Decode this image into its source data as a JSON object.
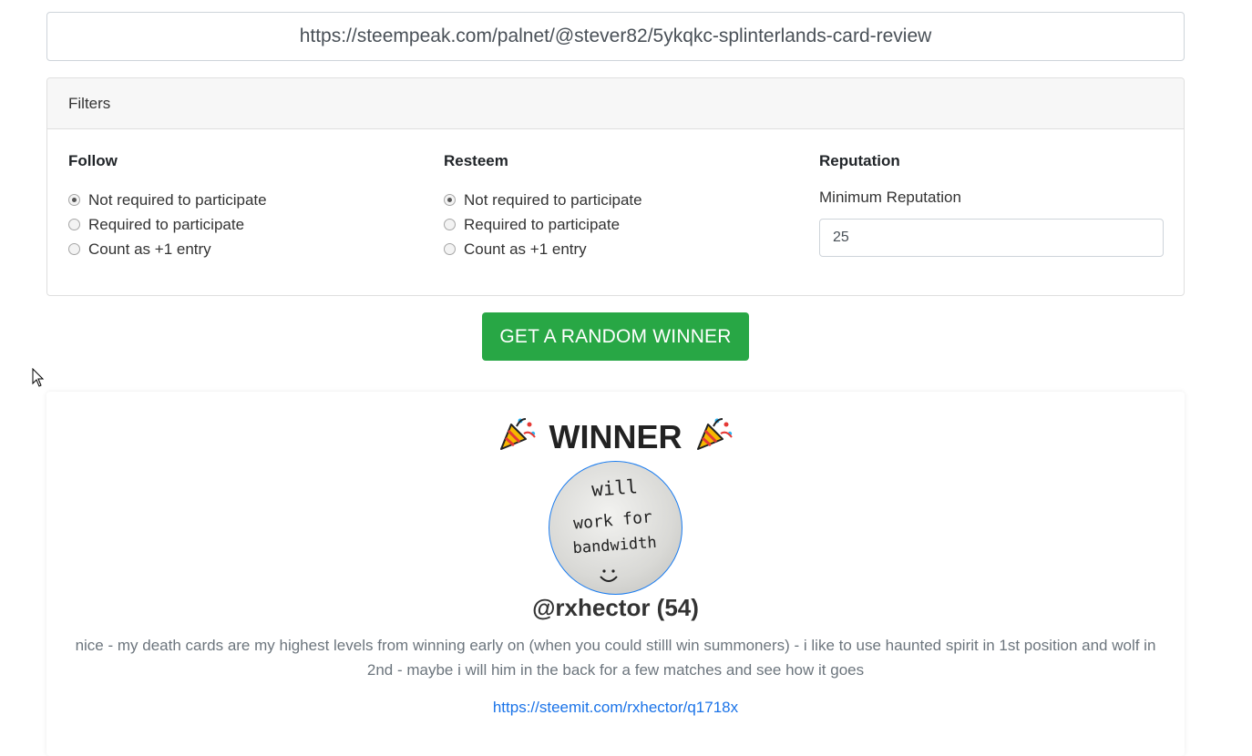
{
  "url_input": {
    "value": "https://steempeak.com/palnet/@stever82/5ykqkc-splinterlands-card-review"
  },
  "filters": {
    "header": "Filters",
    "follow": {
      "title": "Follow",
      "options": [
        "Not required to participate",
        "Required to participate",
        "Count as +1 entry"
      ],
      "selected": "Not required to participate"
    },
    "resteem": {
      "title": "Resteem",
      "options": [
        "Not required to participate",
        "Required to participate",
        "Count as +1 entry"
      ],
      "selected": "Not required to participate"
    },
    "reputation": {
      "title": "Reputation",
      "label": "Minimum Reputation",
      "value": "25"
    }
  },
  "action_button": {
    "label": "GET A RANDOM WINNER",
    "color": "#28a745"
  },
  "winner": {
    "title": "WINNER",
    "emoji_icon": "party-popper-icon",
    "avatar_text": [
      "will",
      "work for",
      "bandwidth"
    ],
    "username": "@rxhector (54)",
    "comment": "nice - my death cards are my highest levels from winning early on (when you could stilll win summoners) - i like to use haunted spirit in 1st position and wolf in 2nd - maybe i will him in the back for a few matches and see how it goes",
    "link": "https://steemit.com/rxhector/q1718x"
  },
  "colors": {
    "accent_link": "#1a73e8",
    "avatar_border": "#1a7cf0"
  }
}
